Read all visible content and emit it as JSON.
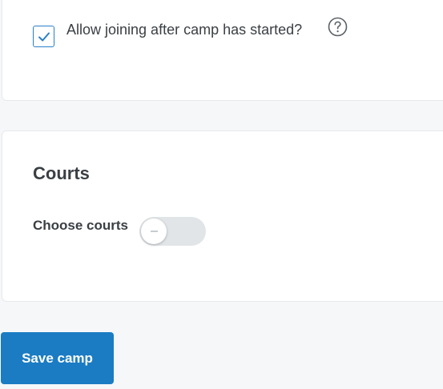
{
  "join_settings": {
    "allow_late_join_label": "Allow joining after camp has started?",
    "allow_late_join_checked": true,
    "help_icon": "question-circle-icon"
  },
  "courts": {
    "title": "Courts",
    "choose_courts_label": "Choose courts",
    "choose_courts_enabled": false
  },
  "actions": {
    "save_label": "Save camp"
  },
  "colors": {
    "accent": "#1b7cc3",
    "toggle_off": "#e1e5e8",
    "text": "#3a3f44"
  }
}
